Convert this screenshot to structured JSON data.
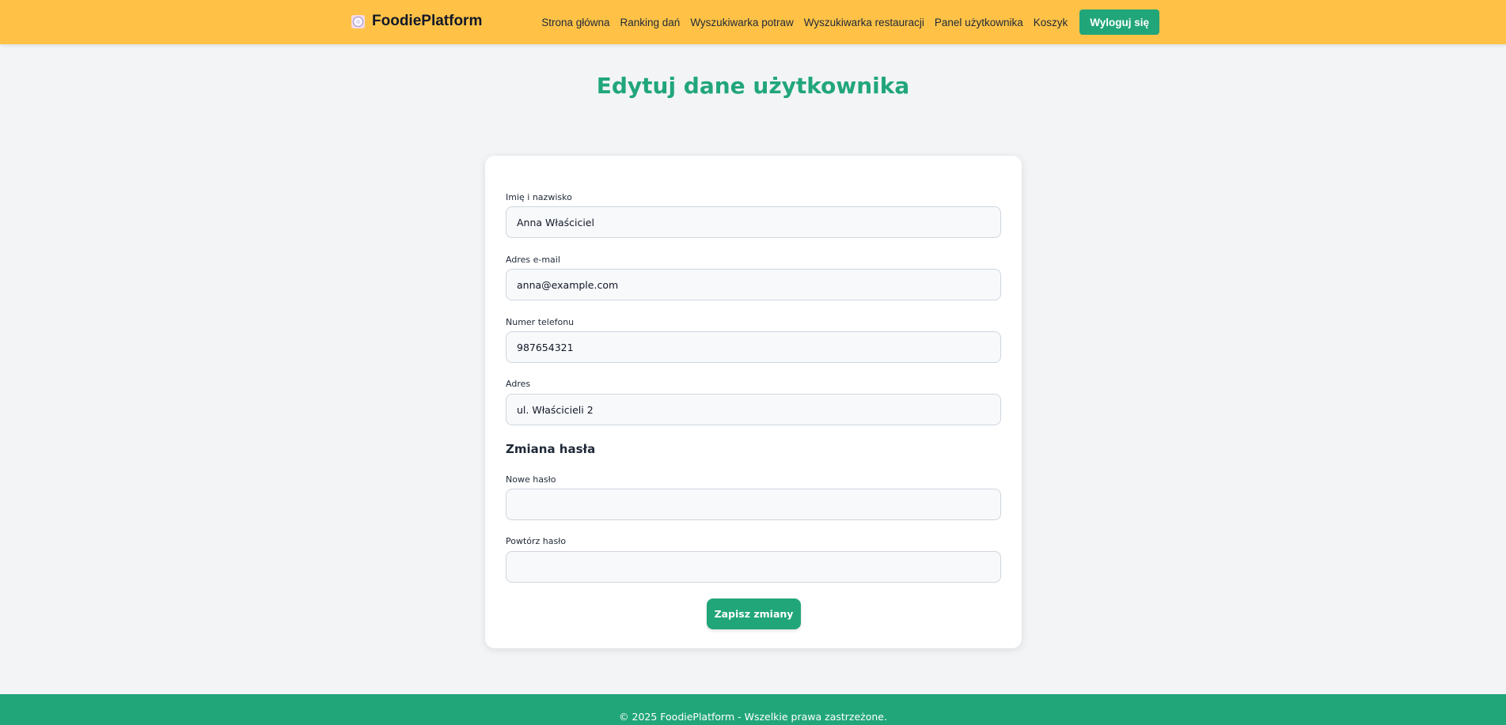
{
  "header": {
    "brand": {
      "icon": "plate-icon",
      "name": "FoodiePlatform"
    },
    "nav": [
      "Strona główna",
      "Ranking dań",
      "Wyszukiwarka potraw",
      "Wyszukiwarka restauracji",
      "Panel użytkownika",
      "Koszyk"
    ],
    "logout_label": "Wyloguj się"
  },
  "page": {
    "title": "Edytuj dane użytkownika"
  },
  "form": {
    "fields": [
      {
        "label": "Imię i nazwisko",
        "value": "Anna Właściciel"
      },
      {
        "label": "Adres e-mail",
        "value": "anna@example.com"
      },
      {
        "label": "Numer telefonu",
        "value": "987654321"
      },
      {
        "label": "Adres",
        "value": "ul. Właścicieli 2"
      }
    ],
    "password_section_title": "Zmiana hasła",
    "password_fields": [
      {
        "label": "Nowe hasło",
        "value": ""
      },
      {
        "label": "Powtórz hasło",
        "value": ""
      }
    ],
    "submit_label": "Zapisz zmiany"
  },
  "footer": {
    "text": "© 2025 FoodiePlatform - Wszelkie prawa zastrzeżone."
  },
  "colors": {
    "header_bg": "#ffc247",
    "accent": "#21a67a",
    "page_bg": "#f2f4f6"
  }
}
